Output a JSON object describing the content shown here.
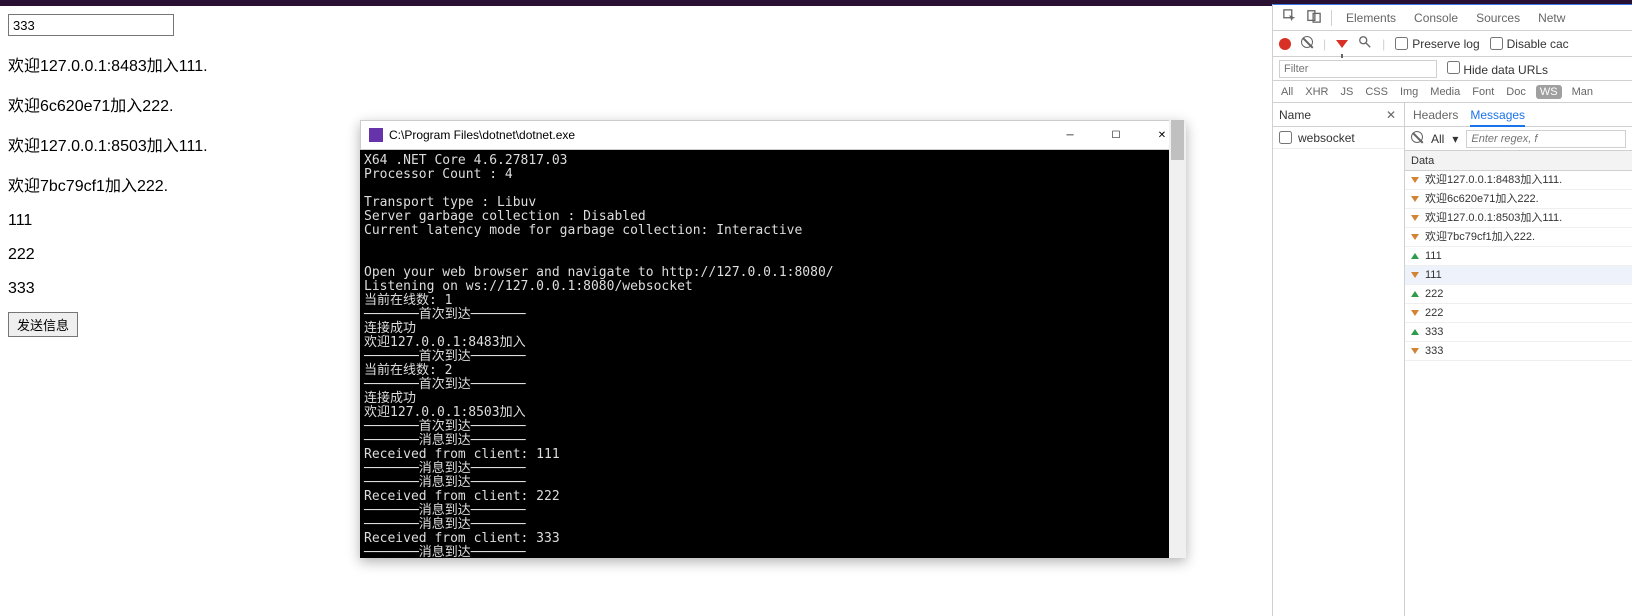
{
  "page": {
    "input_value": "333",
    "lines": [
      "欢迎127.0.0.1:8483加入111.",
      "欢迎6c620e71加入222.",
      "欢迎127.0.0.1:8503加入111.",
      "欢迎7bc79cf1加入222.",
      "111",
      "222",
      "333"
    ],
    "button_label": "发送信息"
  },
  "console": {
    "title_prefix": "C:\\Program Files\\dotnet\\dotnet.exe",
    "body": "X64 .NET Core 4.6.27817.03\nProcessor Count : 4\n\nTransport type : Libuv\nServer garbage collection : Disabled\nCurrent latency mode for garbage collection: Interactive\n\n\nOpen your web browser and navigate to http://127.0.0.1:8080/\nListening on ws://127.0.0.1:8080/websocket\n当前在线数: 1\n───────首次到达───────\n连接成功\n欢迎127.0.0.1:8483加入\n───────首次到达───────\n当前在线数: 2\n───────首次到达───────\n连接成功\n欢迎127.0.0.1:8503加入\n───────首次到达───────\n───────消息到达───────\nReceived from client: 111\n───────消息到达───────\n───────消息到达───────\nReceived from client: 222\n───────消息到达───────\n───────消息到达───────\nReceived from client: 333\n───────消息到达───────\n"
  },
  "devtools": {
    "tabs": {
      "elements": "Elements",
      "console": "Console",
      "sources": "Sources",
      "network": "Netw"
    },
    "preserve_log": "Preserve log",
    "disable_cache": "Disable cac",
    "filter_placeholder": "Filter",
    "hide_data_urls": "Hide data URLs",
    "type_filters": [
      "All",
      "XHR",
      "JS",
      "CSS",
      "Img",
      "Media",
      "Font",
      "Doc",
      "WS",
      "Man"
    ],
    "name_col": "Name",
    "headers_tab": "Headers",
    "messages_tab": "Messages",
    "request_name": "websocket",
    "all_label": "All",
    "regex_placeholder": "Enter regex, f",
    "data_label": "Data",
    "messages": [
      {
        "dir": "down",
        "text": "欢迎127.0.0.1:8483加入111."
      },
      {
        "dir": "down",
        "text": "欢迎6c620e71加入222."
      },
      {
        "dir": "down",
        "text": "欢迎127.0.0.1:8503加入111."
      },
      {
        "dir": "down",
        "text": "欢迎7bc79cf1加入222."
      },
      {
        "dir": "up",
        "text": "111"
      },
      {
        "dir": "down",
        "text": "111",
        "selected": true
      },
      {
        "dir": "up",
        "text": "222"
      },
      {
        "dir": "down",
        "text": "222"
      },
      {
        "dir": "up",
        "text": "333"
      },
      {
        "dir": "down",
        "text": "333"
      }
    ]
  }
}
